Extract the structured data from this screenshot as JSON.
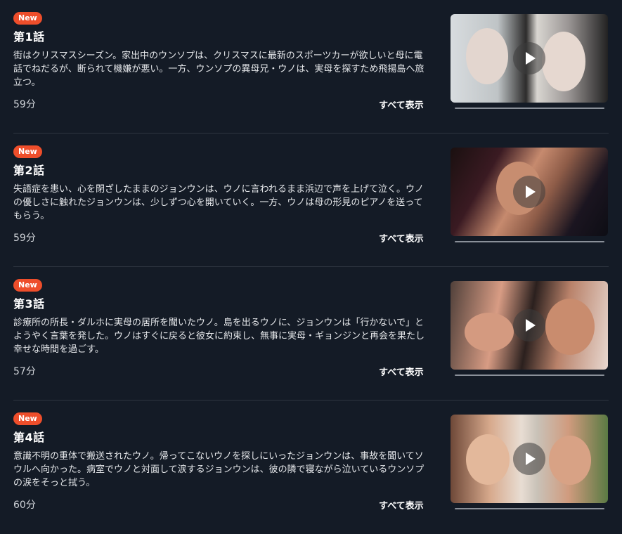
{
  "episodes": [
    {
      "badge": "New",
      "title": "第1話",
      "description": "街はクリスマスシーズン。家出中のウンソプは、クリスマスに最新のスポーツカーが欲しいと母に電話でねだるが、断られて機嫌が悪い。一方、ウンソプの異母兄・ウノは、実母を探すため飛揚島へ旅立つ。",
      "duration": "59分",
      "show_all": "すべて表示"
    },
    {
      "badge": "New",
      "title": "第2話",
      "description": "失語症を患い、心を閉ざしたままのジョンウンは、ウノに言われるまま浜辺で声を上げて泣く。ウノの優しさに触れたジョンウンは、少しずつ心を開いていく。一方、ウノは母の形見のピアノを送ってもらう。",
      "duration": "59分",
      "show_all": "すべて表示"
    },
    {
      "badge": "New",
      "title": "第3話",
      "description": "診療所の所長・ダルホに実母の居所を聞いたウノ。島を出るウノに、ジョンウンは「行かないで」とようやく言葉を発した。ウノはすぐに戻ると彼女に約束し、無事に実母・ギョンジンと再会を果たし幸せな時間を過ごす。",
      "duration": "57分",
      "show_all": "すべて表示"
    },
    {
      "badge": "New",
      "title": "第4話",
      "description": "意識不明の重体で搬送されたウノ。帰ってこないウノを探しにいったジョンウンは、事故を聞いてソウルへ向かった。病室でウノと対面して涙するジョンウンは、彼の隣で寝ながら泣いているウンソプの涙をそっと拭う。",
      "duration": "60分",
      "show_all": "すべて表示"
    }
  ],
  "colors": {
    "background": "#141b26",
    "badge": "#ee4e2b",
    "divider": "#2d3540"
  },
  "icons": {
    "play": "play-icon"
  }
}
